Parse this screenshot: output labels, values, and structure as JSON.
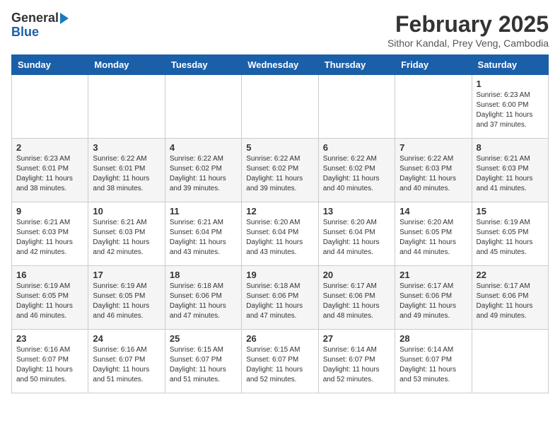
{
  "header": {
    "logo_line1": "General",
    "logo_line2": "Blue",
    "month_title": "February 2025",
    "subtitle": "Sithor Kandal, Prey Veng, Cambodia"
  },
  "weekdays": [
    "Sunday",
    "Monday",
    "Tuesday",
    "Wednesday",
    "Thursday",
    "Friday",
    "Saturday"
  ],
  "weeks": [
    [
      {
        "day": "",
        "info": ""
      },
      {
        "day": "",
        "info": ""
      },
      {
        "day": "",
        "info": ""
      },
      {
        "day": "",
        "info": ""
      },
      {
        "day": "",
        "info": ""
      },
      {
        "day": "",
        "info": ""
      },
      {
        "day": "1",
        "info": "Sunrise: 6:23 AM\nSunset: 6:00 PM\nDaylight: 11 hours\nand 37 minutes."
      }
    ],
    [
      {
        "day": "2",
        "info": "Sunrise: 6:23 AM\nSunset: 6:01 PM\nDaylight: 11 hours\nand 38 minutes."
      },
      {
        "day": "3",
        "info": "Sunrise: 6:22 AM\nSunset: 6:01 PM\nDaylight: 11 hours\nand 38 minutes."
      },
      {
        "day": "4",
        "info": "Sunrise: 6:22 AM\nSunset: 6:02 PM\nDaylight: 11 hours\nand 39 minutes."
      },
      {
        "day": "5",
        "info": "Sunrise: 6:22 AM\nSunset: 6:02 PM\nDaylight: 11 hours\nand 39 minutes."
      },
      {
        "day": "6",
        "info": "Sunrise: 6:22 AM\nSunset: 6:02 PM\nDaylight: 11 hours\nand 40 minutes."
      },
      {
        "day": "7",
        "info": "Sunrise: 6:22 AM\nSunset: 6:03 PM\nDaylight: 11 hours\nand 40 minutes."
      },
      {
        "day": "8",
        "info": "Sunrise: 6:21 AM\nSunset: 6:03 PM\nDaylight: 11 hours\nand 41 minutes."
      }
    ],
    [
      {
        "day": "9",
        "info": "Sunrise: 6:21 AM\nSunset: 6:03 PM\nDaylight: 11 hours\nand 42 minutes."
      },
      {
        "day": "10",
        "info": "Sunrise: 6:21 AM\nSunset: 6:03 PM\nDaylight: 11 hours\nand 42 minutes."
      },
      {
        "day": "11",
        "info": "Sunrise: 6:21 AM\nSunset: 6:04 PM\nDaylight: 11 hours\nand 43 minutes."
      },
      {
        "day": "12",
        "info": "Sunrise: 6:20 AM\nSunset: 6:04 PM\nDaylight: 11 hours\nand 43 minutes."
      },
      {
        "day": "13",
        "info": "Sunrise: 6:20 AM\nSunset: 6:04 PM\nDaylight: 11 hours\nand 44 minutes."
      },
      {
        "day": "14",
        "info": "Sunrise: 6:20 AM\nSunset: 6:05 PM\nDaylight: 11 hours\nand 44 minutes."
      },
      {
        "day": "15",
        "info": "Sunrise: 6:19 AM\nSunset: 6:05 PM\nDaylight: 11 hours\nand 45 minutes."
      }
    ],
    [
      {
        "day": "16",
        "info": "Sunrise: 6:19 AM\nSunset: 6:05 PM\nDaylight: 11 hours\nand 46 minutes."
      },
      {
        "day": "17",
        "info": "Sunrise: 6:19 AM\nSunset: 6:05 PM\nDaylight: 11 hours\nand 46 minutes."
      },
      {
        "day": "18",
        "info": "Sunrise: 6:18 AM\nSunset: 6:06 PM\nDaylight: 11 hours\nand 47 minutes."
      },
      {
        "day": "19",
        "info": "Sunrise: 6:18 AM\nSunset: 6:06 PM\nDaylight: 11 hours\nand 47 minutes."
      },
      {
        "day": "20",
        "info": "Sunrise: 6:17 AM\nSunset: 6:06 PM\nDaylight: 11 hours\nand 48 minutes."
      },
      {
        "day": "21",
        "info": "Sunrise: 6:17 AM\nSunset: 6:06 PM\nDaylight: 11 hours\nand 49 minutes."
      },
      {
        "day": "22",
        "info": "Sunrise: 6:17 AM\nSunset: 6:06 PM\nDaylight: 11 hours\nand 49 minutes."
      }
    ],
    [
      {
        "day": "23",
        "info": "Sunrise: 6:16 AM\nSunset: 6:07 PM\nDaylight: 11 hours\nand 50 minutes."
      },
      {
        "day": "24",
        "info": "Sunrise: 6:16 AM\nSunset: 6:07 PM\nDaylight: 11 hours\nand 51 minutes."
      },
      {
        "day": "25",
        "info": "Sunrise: 6:15 AM\nSunset: 6:07 PM\nDaylight: 11 hours\nand 51 minutes."
      },
      {
        "day": "26",
        "info": "Sunrise: 6:15 AM\nSunset: 6:07 PM\nDaylight: 11 hours\nand 52 minutes."
      },
      {
        "day": "27",
        "info": "Sunrise: 6:14 AM\nSunset: 6:07 PM\nDaylight: 11 hours\nand 52 minutes."
      },
      {
        "day": "28",
        "info": "Sunrise: 6:14 AM\nSunset: 6:07 PM\nDaylight: 11 hours\nand 53 minutes."
      },
      {
        "day": "",
        "info": ""
      }
    ]
  ]
}
